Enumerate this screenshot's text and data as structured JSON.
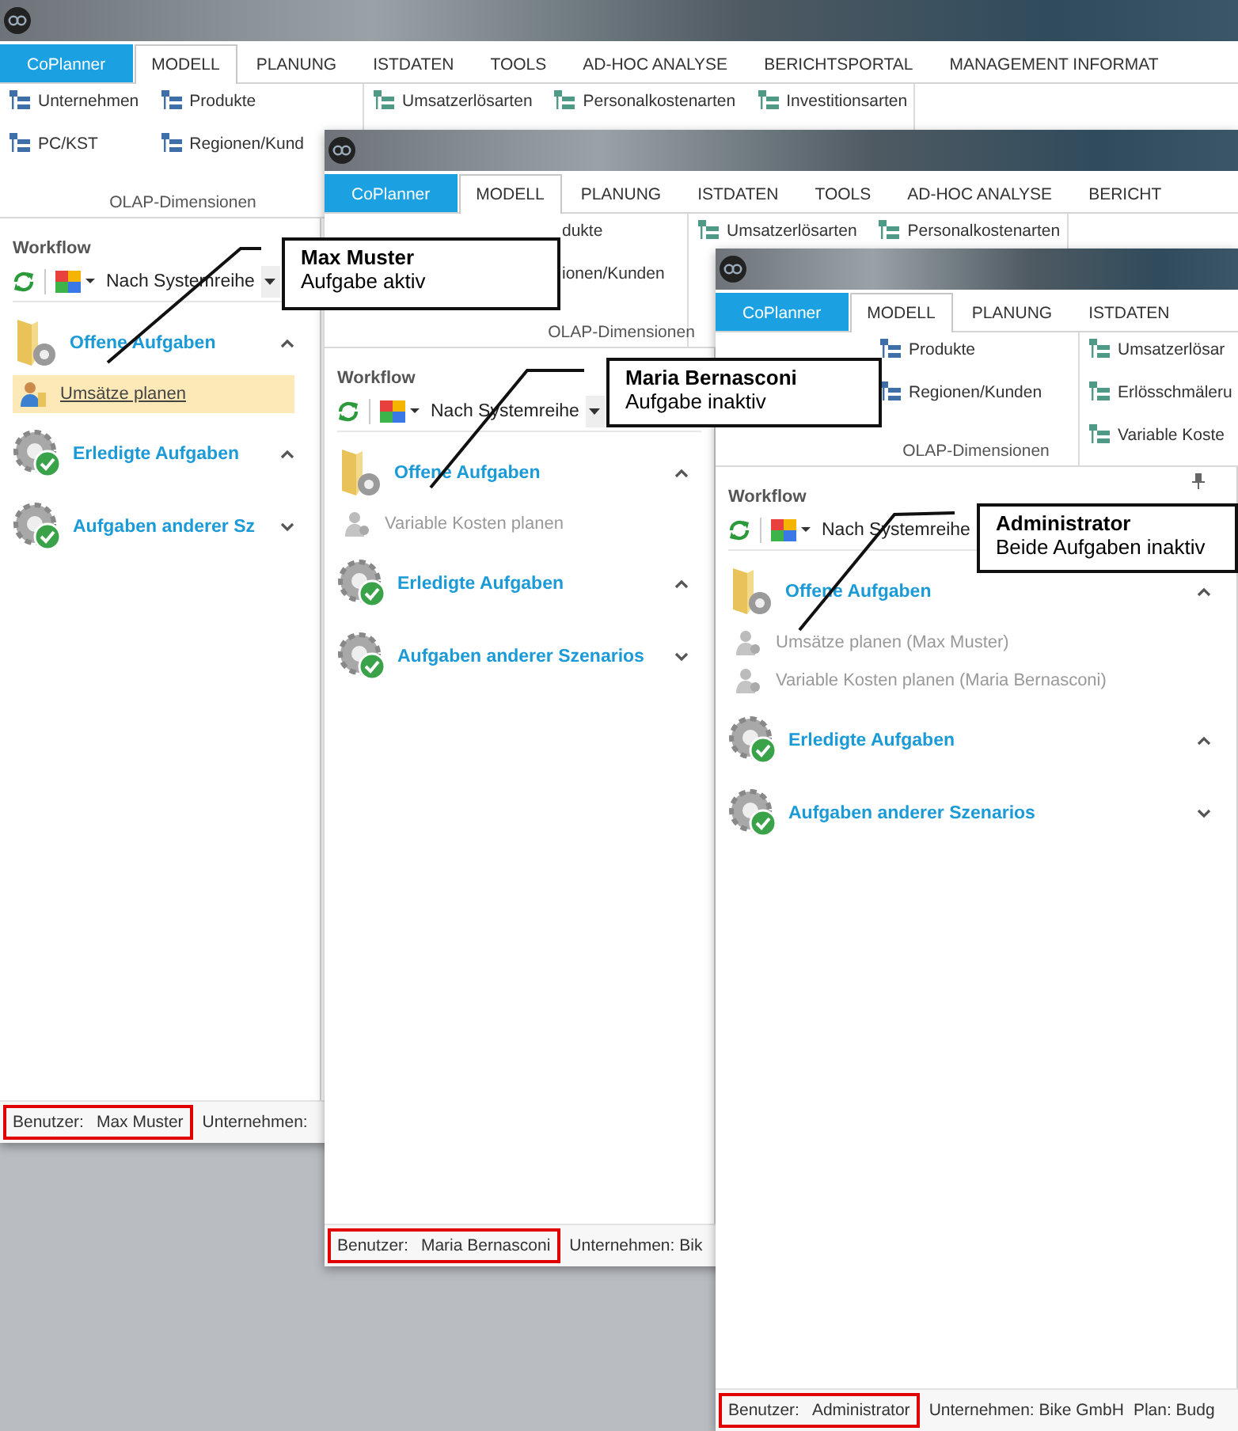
{
  "windows": [
    {
      "tabs": [
        {
          "label": "CoPlanner",
          "kind": "app",
          "selected": false
        },
        {
          "label": "MODELL",
          "kind": "tab",
          "selected": true
        },
        {
          "label": "PLANUNG",
          "kind": "tab",
          "selected": false
        },
        {
          "label": "ISTDATEN",
          "kind": "tab",
          "selected": false
        },
        {
          "label": "TOOLS",
          "kind": "tab",
          "selected": false
        },
        {
          "label": "AD-HOC ANALYSE",
          "kind": "tab",
          "selected": false
        },
        {
          "label": "BERICHTSPORTAL",
          "kind": "tab",
          "selected": false
        },
        {
          "label": "MANAGEMENT INFORMAT",
          "kind": "tab",
          "selected": false
        }
      ],
      "ribbon_groups": [
        {
          "columns": [
            [
              "Unternehmen",
              "PC/KST"
            ],
            [
              "Produkte",
              "Regionen/Kund"
            ]
          ],
          "label": "OLAP-Dimensionen"
        },
        {
          "columns": [
            [
              "Umsatzerlösarten"
            ],
            [
              "Personalkostenarten"
            ],
            [
              "Investitionsarten"
            ]
          ]
        }
      ],
      "workflow": {
        "title": "Workflow",
        "grouping": "Nach Systemreihe",
        "sections": [
          {
            "kind": "open",
            "title": "Offene Aufgaben",
            "expanded": true,
            "tasks": [
              {
                "label": "Umsätze planen",
                "active": true
              }
            ]
          },
          {
            "kind": "done",
            "title": "Erledigte Aufgaben",
            "expanded": true
          },
          {
            "kind": "done",
            "title": "Aufgaben anderer Sz",
            "expanded": false
          }
        ]
      },
      "status_bar": {
        "user_label": "Benutzer:",
        "user": "Max Muster",
        "highlighted": true,
        "others": [
          "Unternehmen:"
        ]
      }
    },
    {
      "tabs": [
        {
          "label": "CoPlanner",
          "kind": "app",
          "selected": false
        },
        {
          "label": "MODELL",
          "kind": "tab",
          "selected": true
        },
        {
          "label": "PLANUNG",
          "kind": "tab",
          "selected": false
        },
        {
          "label": "ISTDATEN",
          "kind": "tab",
          "selected": false
        },
        {
          "label": "TOOLS",
          "kind": "tab",
          "selected": false
        },
        {
          "label": "AD-HOC ANALYSE",
          "kind": "tab",
          "selected": false
        },
        {
          "label": "BERICHT",
          "kind": "tab",
          "selected": false
        }
      ],
      "ribbon_groups": [
        {
          "columns": [
            [
              "dukte",
              "ionen/Kunden"
            ]
          ],
          "label": "OLAP-Dimensionen"
        },
        {
          "columns": [
            [
              "Umsatzerlösarten"
            ],
            [
              "Personalkostenarten"
            ]
          ]
        }
      ],
      "workflow": {
        "title": "Workflow",
        "grouping": "Nach Systemreihe",
        "sections": [
          {
            "kind": "open",
            "title": "Offene Aufgaben",
            "expanded": true,
            "tasks": [
              {
                "label": "Variable Kosten planen",
                "active": false
              }
            ]
          },
          {
            "kind": "done",
            "title": "Erledigte Aufgaben",
            "expanded": true
          },
          {
            "kind": "done",
            "title": "Aufgaben anderer Szenarios",
            "expanded": false
          }
        ]
      },
      "status_bar": {
        "user_label": "Benutzer:",
        "user": "Maria Bernasconi",
        "highlighted": true,
        "others": [
          "Unternehmen: Bik"
        ]
      }
    },
    {
      "tabs": [
        {
          "label": "CoPlanner",
          "kind": "app",
          "selected": false
        },
        {
          "label": "MODELL",
          "kind": "tab",
          "selected": true
        },
        {
          "label": "PLANUNG",
          "kind": "tab",
          "selected": false
        },
        {
          "label": "ISTDATEN",
          "kind": "tab",
          "selected": false
        }
      ],
      "ribbon_groups": [
        {
          "columns": [
            [
              "Produkte",
              "Regionen/Kunden"
            ]
          ],
          "label": "OLAP-Dimensionen"
        },
        {
          "columns": [
            [
              "Umsatzerlösar",
              "Erlösschmäleru",
              "Variable Koste"
            ]
          ]
        }
      ],
      "workflow": {
        "title": "Workflow",
        "grouping": "Nach Systemreihe",
        "sections": [
          {
            "kind": "open",
            "title": "Offene Aufgaben",
            "expanded": true,
            "tasks": [
              {
                "label": "Umsätze planen (Max Muster)",
                "active": false
              },
              {
                "label": "Variable Kosten planen (Maria Bernasconi)",
                "active": false
              }
            ]
          },
          {
            "kind": "done",
            "title": "Erledigte Aufgaben",
            "expanded": true
          },
          {
            "kind": "done",
            "title": "Aufgaben anderer Szenarios",
            "expanded": false
          }
        ]
      },
      "status_bar": {
        "user_label": "Benutzer:",
        "user": "Administrator",
        "highlighted": true,
        "others": [
          "Unternehmen: Bike GmbH",
          "Plan: Budg"
        ]
      }
    }
  ],
  "callouts": [
    {
      "title": "Max Muster",
      "text": "Aufgabe aktiv"
    },
    {
      "title": "Maria Bernasconi",
      "text": "Aufgabe inaktiv"
    },
    {
      "title": "Administrator",
      "text": "Beide Aufgaben inaktiv"
    }
  ]
}
